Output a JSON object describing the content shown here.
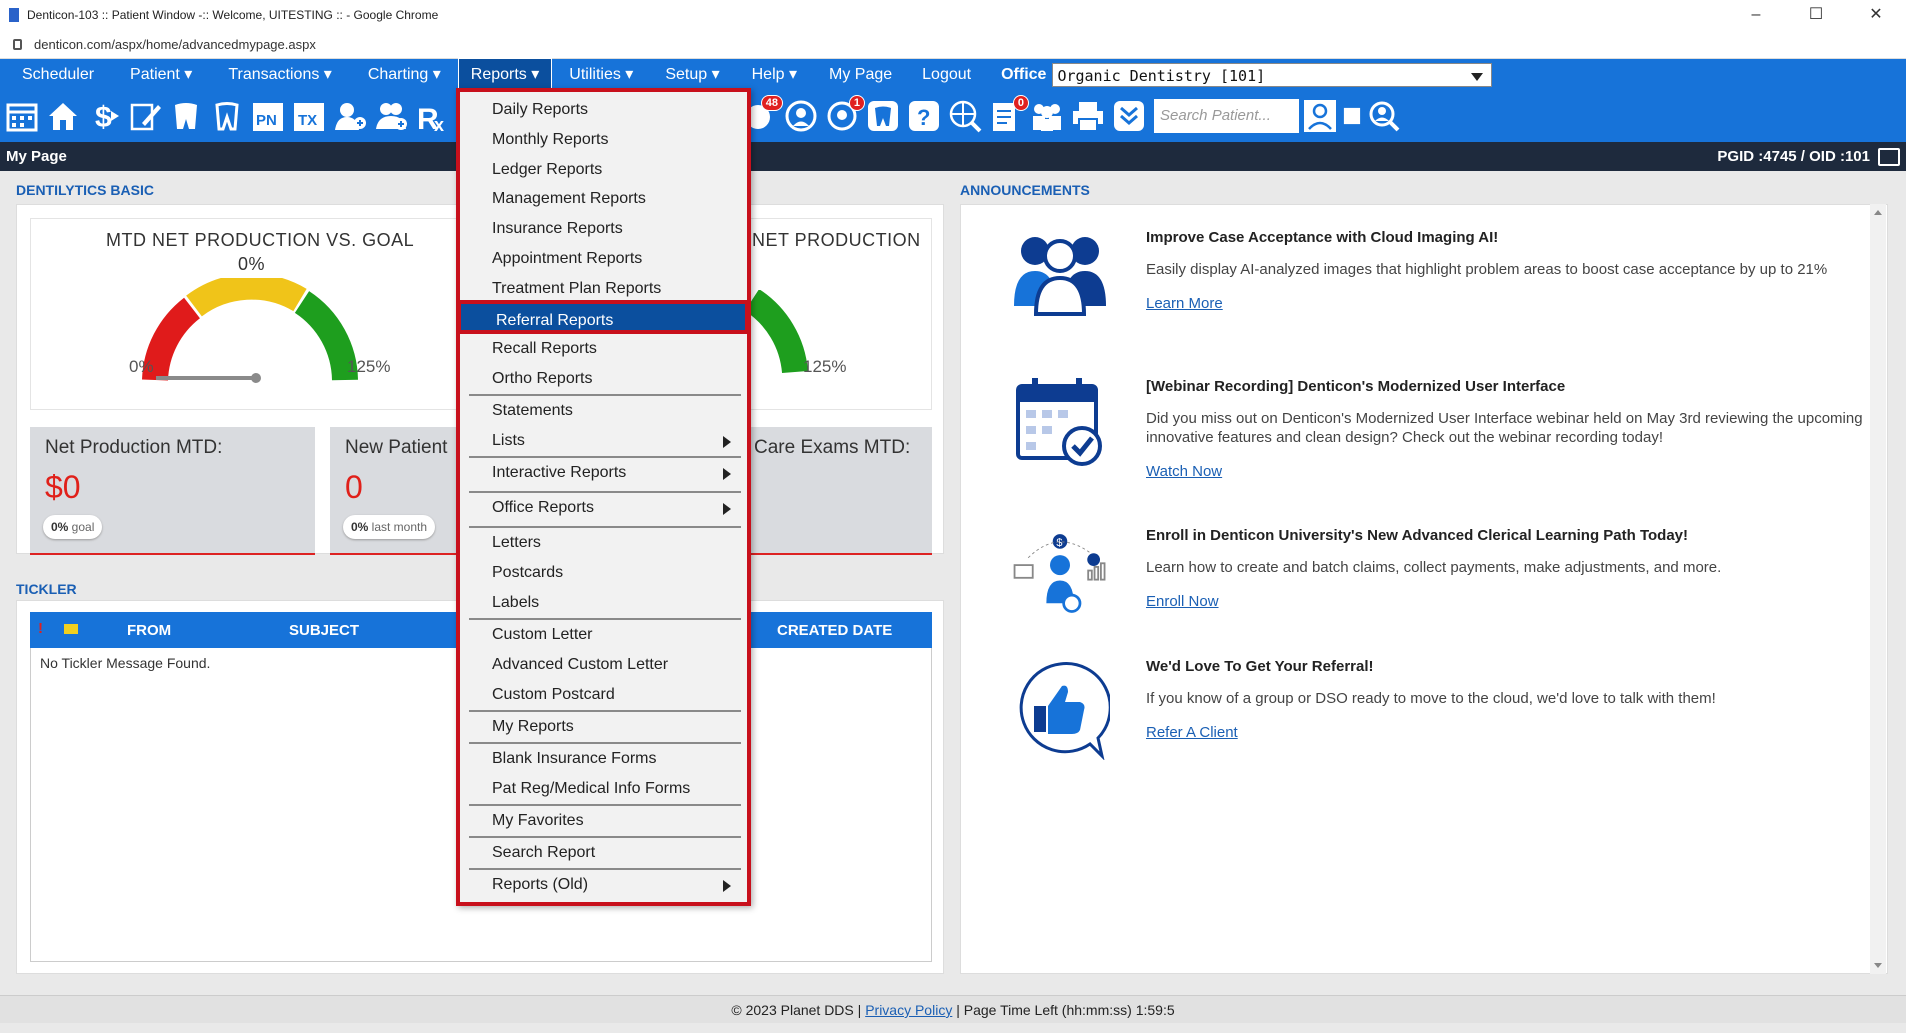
{
  "browser": {
    "title": "Denticon-103 :: Patient Window -:: Welcome, UITESTING :: - Google Chrome",
    "url": "denticon.com/aspx/home/advancedmypage.aspx"
  },
  "menubar": {
    "items": [
      "Scheduler",
      "Patient ▾",
      "Transactions ▾",
      "Charting ▾",
      "Reports ▾",
      "Utilities ▾",
      "Setup ▾",
      "Help ▾",
      "My Page",
      "Logout"
    ],
    "office_label": "Office",
    "office_value": "Organic Dentistry [101]"
  },
  "toolbar": {
    "badge_1": "48",
    "badge_2": "1",
    "badge_3": "0",
    "search_placeholder": "Search Patient..."
  },
  "page_header": {
    "title": "My Page",
    "ids": "PGID :4745  /  OID :101"
  },
  "dentilytics": {
    "section_title": "DENTILYTICS BASIC",
    "gauge1_title": "MTD NET PRODUCTION VS. GOAL",
    "gauge1_value": "0%",
    "gauge1_min": "0%",
    "gauge1_max": "125%",
    "gauge2_title": "NET PRODUCTION",
    "gauge2_max": "125%",
    "kpis": [
      {
        "label": "Net Production MTD:",
        "value": "$0",
        "pill_bold": "0%",
        "pill_text": " goal"
      },
      {
        "label": "New Patient",
        "value": "0",
        "pill_bold": "0%",
        "pill_text": " last month"
      },
      {
        "label": "Care Exams MTD:",
        "value": "",
        "pill_bold": "",
        "pill_text": ""
      }
    ]
  },
  "tickler": {
    "section_title": "TICKLER",
    "columns": [
      "FROM",
      "SUBJECT",
      "CREATED DATE"
    ],
    "empty": "No Tickler Message Found."
  },
  "announcements": {
    "section_title": "ANNOUNCEMENTS",
    "items": [
      {
        "title": "Improve Case Acceptance with Cloud Imaging AI!",
        "desc": "Easily display AI-analyzed images that highlight problem areas to boost case acceptance by up to 21%",
        "link": "Learn More"
      },
      {
        "title": "[Webinar Recording] Denticon's Modernized User Interface",
        "desc": "Did you miss out on Denticon's Modernized User Interface webinar held on May 3rd reviewing the upcoming innovative features and clean design? Check out the webinar recording today!",
        "link": "Watch Now"
      },
      {
        "title": "Enroll in Denticon University's New Advanced Clerical Learning Path Today!",
        "desc": "Learn how to create and batch claims, collect payments, make adjustments, and more.",
        "link": "Enroll Now"
      },
      {
        "title": "We'd Love To Get Your Referral!",
        "desc": "If you know of a group or DSO ready to move to the cloud, we'd love to talk with them!",
        "link": "Refer A Client"
      }
    ]
  },
  "reports_menu": {
    "items": [
      "Daily Reports",
      "Monthly Reports",
      "Ledger Reports",
      "Management Reports",
      "Insurance Reports",
      "Appointment Reports",
      "Treatment Plan Reports",
      "Referral Reports",
      "Recall Reports",
      "Ortho Reports",
      "Statements",
      "Lists",
      "Interactive Reports",
      "Office Reports",
      "Letters",
      "Postcards",
      "Labels",
      "Custom Letter",
      "Advanced Custom Letter",
      "Custom Postcard",
      "My Reports",
      "Blank Insurance Forms",
      "Pat Reg/Medical Info Forms",
      "My Favorites",
      "Search Report",
      "Reports (Old)"
    ]
  },
  "footer": {
    "copyright": "© 2023 Planet DDS |",
    "privacy": "Privacy Policy",
    "time_left": "| Page Time Left (hh:mm:ss) 1:59:5"
  }
}
